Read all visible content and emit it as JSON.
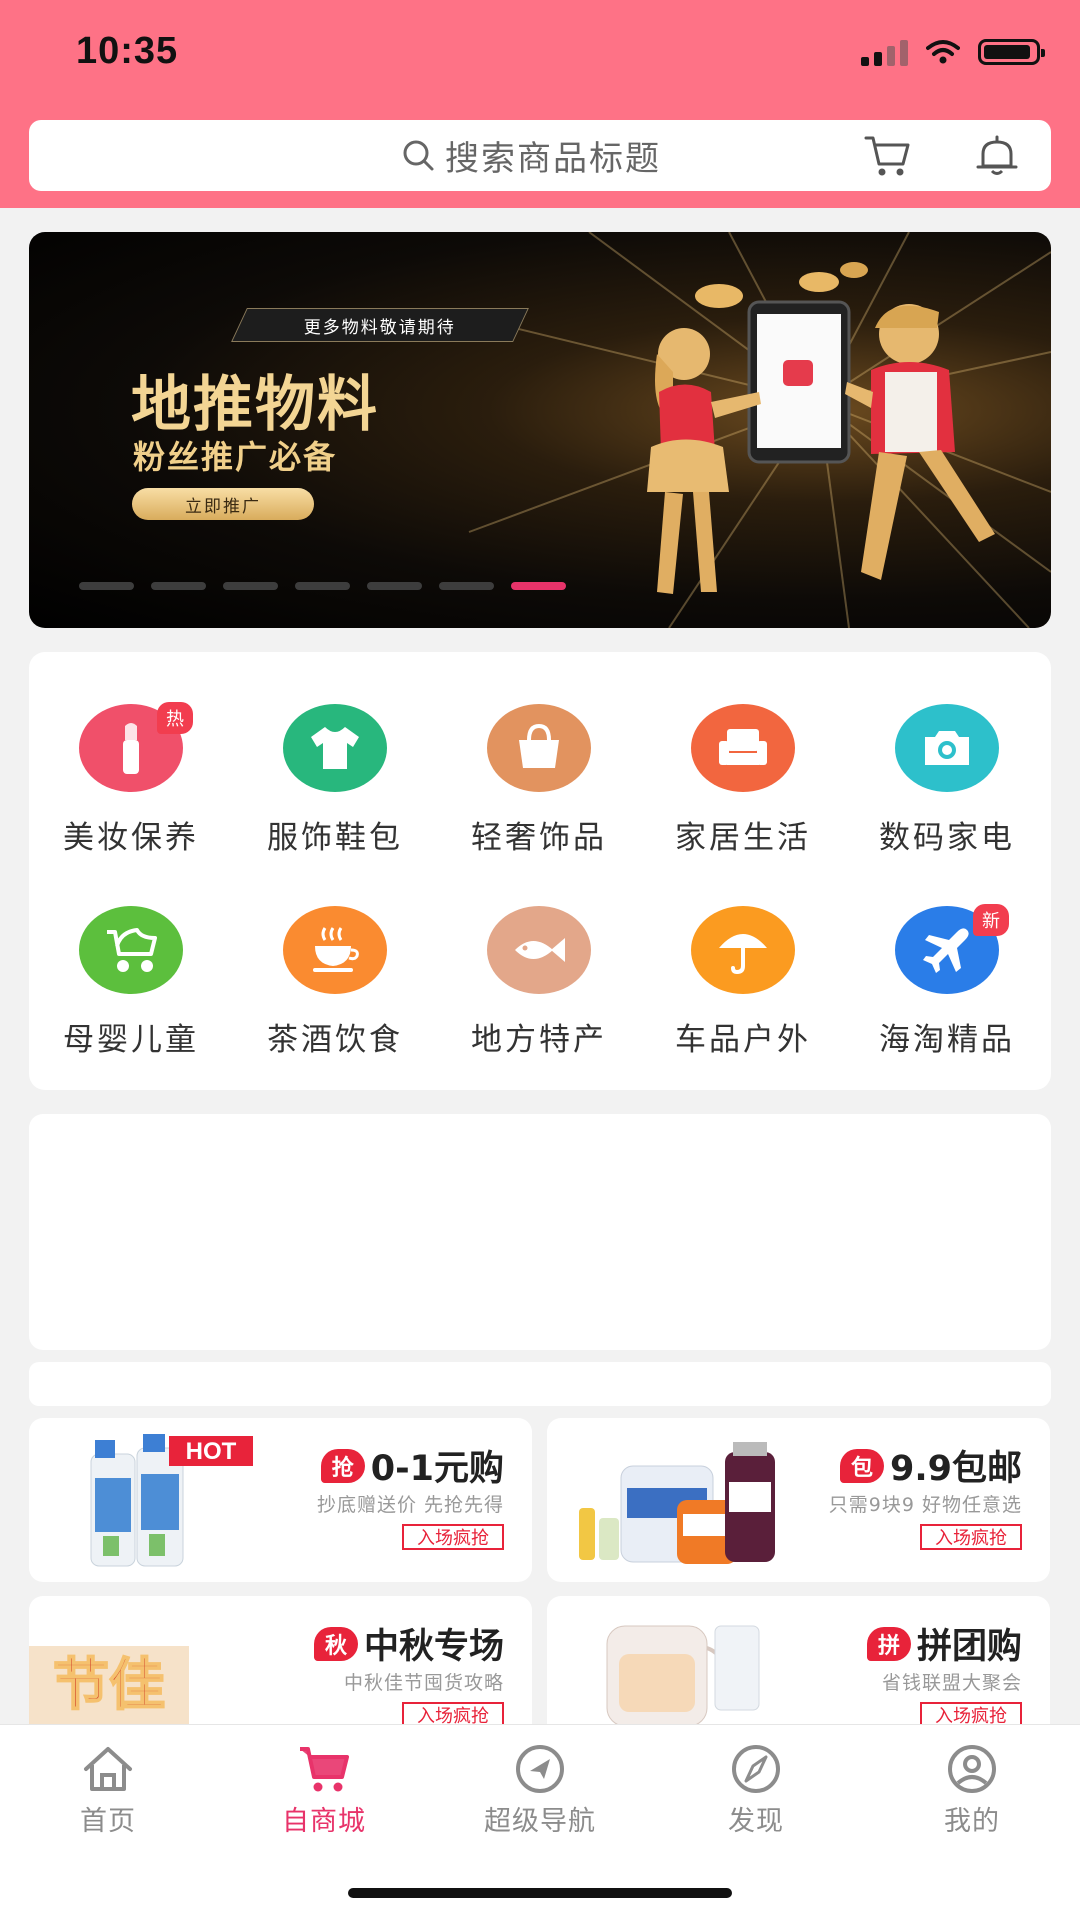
{
  "status_bar": {
    "time": "10:35"
  },
  "search": {
    "placeholder": "搜索商品标题"
  },
  "banner": {
    "tag": "更多物料敬请期待",
    "title": "地推物料",
    "subtitle": "粉丝推广必备",
    "button": "立即推广",
    "slides": 7,
    "active_slide": 7
  },
  "categories": [
    {
      "label": "美妆保养",
      "icon": "lipstick-icon",
      "color": "#f0506a",
      "badge": "热"
    },
    {
      "label": "服饰鞋包",
      "icon": "shirt-icon",
      "color": "#28b77d",
      "badge": ""
    },
    {
      "label": "轻奢饰品",
      "icon": "handbag-icon",
      "color": "#e2935f",
      "badge": ""
    },
    {
      "label": "家居生活",
      "icon": "sofa-icon",
      "color": "#f2663f",
      "badge": ""
    },
    {
      "label": "数码家电",
      "icon": "camera-icon",
      "color": "#2dc0cb",
      "badge": ""
    },
    {
      "label": "母婴儿童",
      "icon": "stroller-icon",
      "color": "#5cbf3d",
      "badge": ""
    },
    {
      "label": "茶酒饮食",
      "icon": "teacup-icon",
      "color": "#fa8b30",
      "badge": ""
    },
    {
      "label": "地方特产",
      "icon": "fish-icon",
      "color": "#e3a78a",
      "badge": ""
    },
    {
      "label": "车品户外",
      "icon": "umbrella-icon",
      "color": "#fb9b20",
      "badge": ""
    },
    {
      "label": "海淘精品",
      "icon": "airplane-icon",
      "color": "#2a7de8",
      "badge": "新"
    }
  ],
  "promos": [
    {
      "badge": "抢",
      "title": "0-1元购",
      "subtitle": "抄底赠送价 先抢先得",
      "button": "入场疯抢",
      "art_text": "HOT"
    },
    {
      "badge": "包",
      "title": "9.9包邮",
      "subtitle": "只需9块9 好物任意选",
      "button": "入场疯抢"
    },
    {
      "badge": "秋",
      "title": "中秋专场",
      "subtitle": "中秋佳节囤货攻略",
      "button": "入场疯抢",
      "art_text": "节佳"
    },
    {
      "badge": "拼",
      "title": "拼团购",
      "subtitle": "省钱联盟大聚会",
      "button": "入场疯抢"
    }
  ],
  "tabs": [
    {
      "label": "首页",
      "icon": "home-icon",
      "active": false
    },
    {
      "label": "自商城",
      "icon": "shopping-cart-icon",
      "active": true
    },
    {
      "label": "超级导航",
      "icon": "navigation-icon",
      "active": false
    },
    {
      "label": "发现",
      "icon": "compass-icon",
      "active": false
    },
    {
      "label": "我的",
      "icon": "user-icon",
      "active": false
    }
  ],
  "colors": {
    "header": "#fe7286",
    "accent": "#e8336a",
    "promo_red": "#e8233a"
  }
}
